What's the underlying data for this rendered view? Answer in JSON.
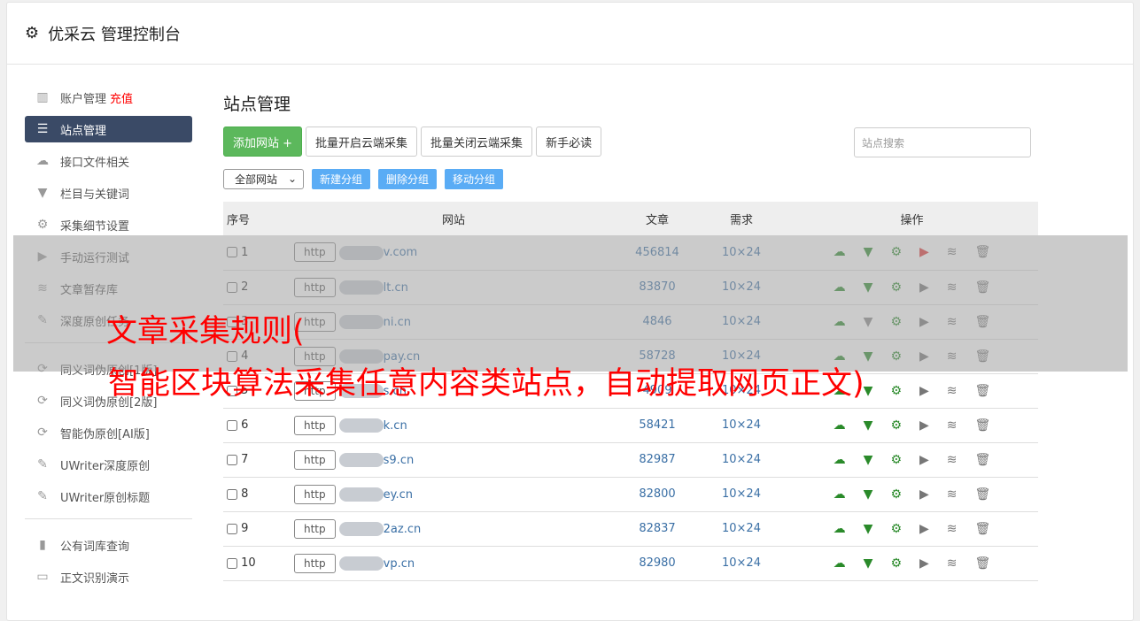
{
  "header": {
    "title": "优采云 管理控制台",
    "icon": "gear-icon"
  },
  "sidebar": {
    "items": [
      {
        "label": "账户管理",
        "extra": "充值",
        "icon": "bar-chart-icon"
      },
      {
        "label": "站点管理",
        "icon": "server-icon",
        "active": true
      },
      {
        "label": "接口文件相关",
        "icon": "cloud-upload-icon"
      },
      {
        "label": "栏目与关键词",
        "icon": "filter-icon"
      },
      {
        "label": "采集细节设置",
        "icon": "gears-icon"
      },
      {
        "label": "手动运行测试",
        "icon": "play-icon"
      },
      {
        "label": "文章暂存库",
        "icon": "database-icon"
      },
      {
        "label": "深度原创任务",
        "icon": "edit-icon"
      },
      {
        "label": "同义词伪原创[1版]",
        "icon": "refresh-icon"
      },
      {
        "label": "同义词伪原创[2版]",
        "icon": "refresh-icon"
      },
      {
        "label": "智能伪原创[AI版]",
        "icon": "refresh-icon"
      },
      {
        "label": "UWriter深度原创",
        "icon": "edit-icon"
      },
      {
        "label": "UWriter原创标题",
        "icon": "edit-icon"
      },
      {
        "label": "公有词库查询",
        "icon": "book-icon"
      },
      {
        "label": "正文识别演示",
        "icon": "monitor-icon"
      }
    ]
  },
  "main": {
    "title": "站点管理",
    "add_site": "添加网站 +",
    "batch_on": "批量开启云端采集",
    "batch_off": "批量关闭云端采集",
    "guide": "新手必读",
    "search_placeholder": "站点搜索",
    "group_select": "全部网站",
    "new_group": "新建分组",
    "delete_group": "删除分组",
    "move_group": "移动分组",
    "columns": [
      "序号",
      "网站",
      "文章",
      "需求",
      "操作"
    ],
    "rows": [
      {
        "no": "1",
        "protocol": "http",
        "site": "v.com",
        "articles": "456814",
        "demand": "10×24"
      },
      {
        "no": "2",
        "protocol": "http",
        "site": "lt.cn",
        "articles": "83870",
        "demand": "10×24"
      },
      {
        "no": "3",
        "protocol": "http",
        "site": "ni.cn",
        "articles": "4846",
        "demand": "10×24"
      },
      {
        "no": "4",
        "protocol": "http",
        "site": "pay.cn",
        "articles": "58728",
        "demand": "10×24"
      },
      {
        "no": "5",
        "protocol": "http",
        "site": "s.cn",
        "articles": "4909",
        "demand": "10×24"
      },
      {
        "no": "6",
        "protocol": "http",
        "site": "k.cn",
        "articles": "58421",
        "demand": "10×24"
      },
      {
        "no": "7",
        "protocol": "http",
        "site": "s9.cn",
        "articles": "82987",
        "demand": "10×24"
      },
      {
        "no": "8",
        "protocol": "http",
        "site": "ey.cn",
        "articles": "82800",
        "demand": "10×24"
      },
      {
        "no": "9",
        "protocol": "http",
        "site": "2az.cn",
        "articles": "82837",
        "demand": "10×24"
      },
      {
        "no": "10",
        "protocol": "http",
        "site": "vp.cn",
        "articles": "82980",
        "demand": "10×24"
      }
    ]
  },
  "overlay": {
    "line1": "文章采集规则(",
    "line2": "智能区块算法采集任意内容类站点，自动提取网页正文)"
  },
  "colors": {
    "active": "#3a4a66",
    "green": "#5cb85c",
    "blue": "#5aacf5",
    "red": "#ff0000"
  }
}
